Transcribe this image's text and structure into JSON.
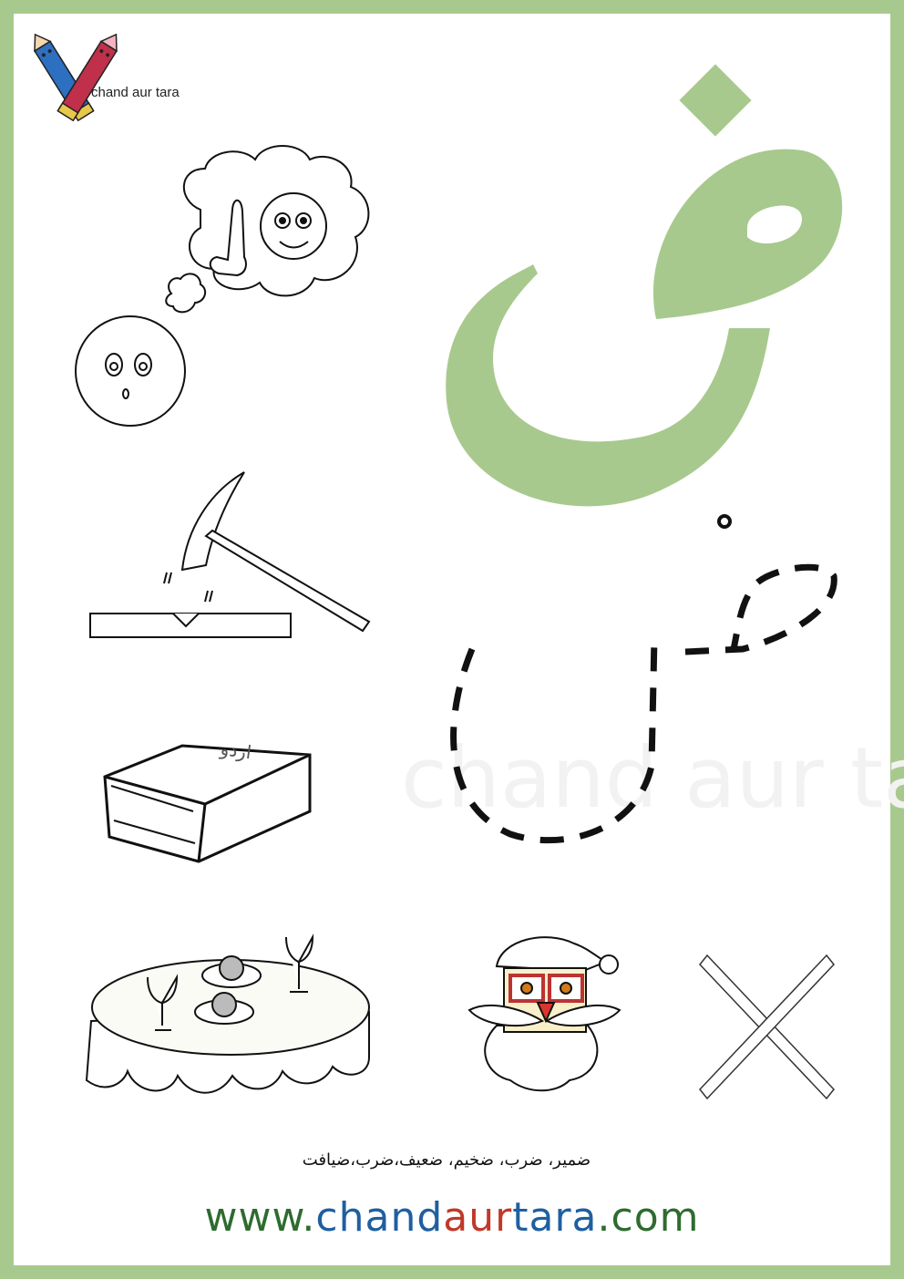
{
  "brand": {
    "logo_text": "chand aur tara",
    "watermark_text": "chand aur ta"
  },
  "letter": {
    "glyph": "ض",
    "color": "#a8c98e"
  },
  "words_line": "ضمیر، ضرب، ضخیم، ضعیف،ضرب،ضیافت",
  "website": {
    "prefix": "www.",
    "part1": "chand",
    "part2": "aur",
    "part3": "tara",
    "suffix": ".com"
  },
  "book_label": "اردو",
  "colors": {
    "frame": "#a8c98e",
    "green": "#2f6b2f",
    "blue": "#1f5fa0",
    "red": "#c0392b"
  },
  "icons": [
    "pencils-logo-icon",
    "thinking-cloud-icon",
    "round-face-icon",
    "pickaxe-icon",
    "book-icon",
    "dining-table-icon",
    "santa-face-icon",
    "cross-icon"
  ]
}
